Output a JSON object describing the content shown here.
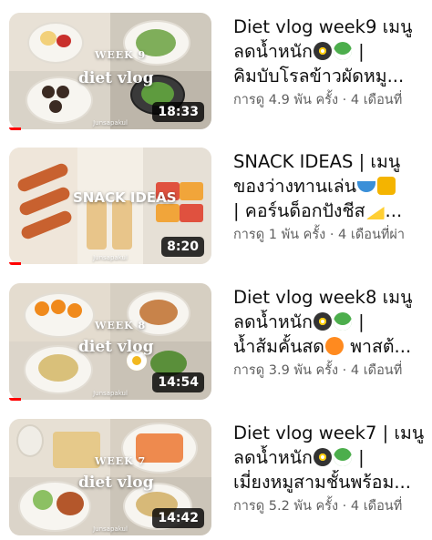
{
  "videos": [
    {
      "title_line1": "Diet vlog week9 เมนู",
      "title_line2": "ลดน้ำหนัก",
      "title_line2_suffix": "|",
      "title_line3": "คิมบับโรลข้าวผัดหมู...",
      "views": "การดู 4.9 พัน ครั้ง · 4 เดือนที่",
      "duration": "18:33",
      "overlay_week": "WEEK 9",
      "overlay_title": "diet vlog",
      "watermark": "Junsapakul",
      "progress": 0.06,
      "icons": [
        "frying-pan-icon",
        "salad-icon"
      ]
    },
    {
      "title_line1": "SNACK IDEAS | เมนู",
      "title_line2": "ของว่างทานเล่น",
      "title_line2_suffix": "",
      "title_line3": "| คอร์นด็อกปังชีส",
      "views": "การดู 1 พัน ครั้ง · 4 เดือนที่ผ่า",
      "duration": "8:20",
      "overlay_week": "",
      "overlay_title": "SNACK IDEAS",
      "watermark": "Junsapakul",
      "progress": 0.06,
      "icons": [
        "bowl-icon",
        "honey-icon",
        "cheese-icon"
      ]
    },
    {
      "title_line1": "Diet vlog week8 เมนู",
      "title_line2": "ลดน้ำหนัก",
      "title_line2_suffix": "|",
      "title_line3": "น้ำส้มคั้นสด",
      "title_line3_suffix": "พาสต้...",
      "views": "การดู 3.9 พัน ครั้ง · 4 เดือนที่",
      "duration": "14:54",
      "overlay_week": "WEEK 8",
      "overlay_title": "diet vlog",
      "watermark": "Junsapakul",
      "progress": 0.06,
      "icons": [
        "frying-pan-icon",
        "salad-icon",
        "orange-icon"
      ]
    },
    {
      "title_line1": "Diet vlog week7 | เมนู",
      "title_line2": "ลดน้ำหนัก",
      "title_line2_suffix": "|",
      "title_line3": "เมี่ยงหมูสามชั้นพร้อม...",
      "views": "การดู 5.2 พัน ครั้ง · 4 เดือนที่",
      "duration": "14:42",
      "overlay_week": "WEEK 7",
      "overlay_title": "diet vlog",
      "watermark": "Junsapakul",
      "progress": 0,
      "icons": [
        "frying-pan-icon",
        "salad-icon"
      ]
    }
  ],
  "colors": {
    "progress": "#ff0000",
    "title": "#0f0f0f",
    "meta": "#606060"
  }
}
